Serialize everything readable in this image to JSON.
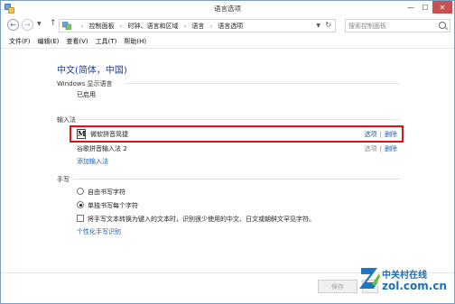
{
  "window": {
    "title": "语言选项",
    "controls": {
      "minimize": "—",
      "maximize": "☐",
      "close": "✕"
    }
  },
  "address": {
    "crumbs": [
      "控制面板",
      "时钟、语言和区域",
      "语言",
      "语言选项"
    ],
    "separator": "›",
    "search_placeholder": "搜索控制面板"
  },
  "menu": [
    "文件(F)",
    "编辑(E)",
    "查看(V)",
    "工具(T)",
    "帮助(H)"
  ],
  "language": {
    "title": "中文(简体，中国)",
    "display_section": "Windows 显示语言",
    "display_status": "已启用"
  },
  "input_methods": {
    "section": "输入法",
    "items": [
      {
        "name": "微软拼音简捷",
        "icon": "M",
        "options": "选项",
        "separator": "|",
        "delete": "删除"
      },
      {
        "name": "谷歌拼音输入法 2",
        "options": "选项",
        "separator": "|",
        "delete": "删除"
      }
    ],
    "add_link": "添加输入法"
  },
  "handwriting": {
    "section": "手写",
    "options": [
      {
        "label": "自由书写字符",
        "selected": false
      },
      {
        "label": "单独书写每个字符",
        "selected": true
      }
    ],
    "checkbox_label": "将手写文本转换为键入的文本时，识别很少使用的中文、日文或朝鲜文罕见字符。",
    "personalize_link": "个性化手写识别"
  },
  "footer": {
    "save": "保存"
  },
  "watermark": {
    "cn": "中关村在线",
    "en": "zol.com.cn"
  },
  "colors": {
    "link": "#1a5fb4",
    "title": "#1c3f94",
    "highlight": "#d8141a",
    "close_button": "#c75050"
  }
}
